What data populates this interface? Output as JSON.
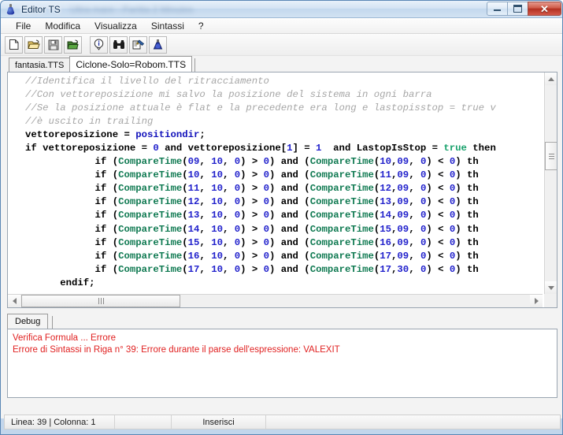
{
  "window": {
    "title": "Editor TS",
    "title_blurred_suffix": "Ultra mare - Partita 2 Minutes",
    "icon": "flask-icon",
    "controls": {
      "minimize": "–",
      "maximize": "□",
      "close": "✕"
    }
  },
  "menubar": {
    "items": [
      {
        "label": "File"
      },
      {
        "label": "Modifica"
      },
      {
        "label": "Visualizza"
      },
      {
        "label": "Sintassi"
      },
      {
        "label": "?"
      }
    ]
  },
  "toolbar": {
    "buttons": [
      {
        "name": "new-file-icon",
        "tip": "Nuovo"
      },
      {
        "name": "open-folder-icon",
        "tip": "Apri"
      },
      {
        "name": "save-floppy-icon",
        "tip": "Salva"
      },
      {
        "name": "save-as-folder-icon",
        "tip": "Salva con nome"
      },
      {
        "name": "info-icon",
        "tip": "Informazioni"
      },
      {
        "name": "binoculars-find-icon",
        "tip": "Cerca"
      },
      {
        "name": "check-syntax-icon",
        "tip": "Verifica Sintassi"
      },
      {
        "name": "flask-icon",
        "tip": "Editor TS"
      }
    ]
  },
  "file_tabs": {
    "tabs": [
      {
        "label": "fantasia.TTS",
        "active": false
      },
      {
        "label": "Ciclone-Solo=Robom.TTS",
        "active": true
      }
    ]
  },
  "editor": {
    "lines": [
      {
        "segments": [
          {
            "t": "//Identifica il livello del ritracciamento",
            "c": "cm"
          }
        ]
      },
      {
        "segments": [
          {
            "t": "//Con vettoreposizione mi salvo la posizione del sistema in ogni barra",
            "c": "cm"
          }
        ]
      },
      {
        "segments": [
          {
            "t": "//Se la posizione attuale è flat e la precedente era long e lastopisstop = true v",
            "c": "cm"
          }
        ]
      },
      {
        "segments": [
          {
            "t": "//è uscito in trailing",
            "c": "cm"
          }
        ]
      },
      {
        "segments": [
          {
            "t": "vettoreposizione = ",
            "c": "plain"
          },
          {
            "t": "positiondir",
            "c": "id"
          },
          {
            "t": ";",
            "c": "plain"
          }
        ]
      },
      {
        "segments": [
          {
            "t": "if vettoreposizione = ",
            "c": "plain"
          },
          {
            "t": "0",
            "c": "num"
          },
          {
            "t": " and vettoreposizione[",
            "c": "plain"
          },
          {
            "t": "1",
            "c": "num"
          },
          {
            "t": "] = ",
            "c": "plain"
          },
          {
            "t": "1",
            "c": "num"
          },
          {
            "t": "  and LastopIsStop = ",
            "c": "plain"
          },
          {
            "t": "true",
            "c": "val"
          },
          {
            "t": " then",
            "c": "plain"
          }
        ]
      },
      {
        "segments": [
          {
            "t": "            if (",
            "c": "plain"
          },
          {
            "t": "CompareTime",
            "c": "fn"
          },
          {
            "t": "(",
            "c": "plain"
          },
          {
            "t": "09",
            "c": "num"
          },
          {
            "t": ", ",
            "c": "plain"
          },
          {
            "t": "10",
            "c": "num"
          },
          {
            "t": ", ",
            "c": "plain"
          },
          {
            "t": "0",
            "c": "num"
          },
          {
            "t": ") > ",
            "c": "plain"
          },
          {
            "t": "0",
            "c": "num"
          },
          {
            "t": ") and (",
            "c": "plain"
          },
          {
            "t": "CompareTime",
            "c": "fn"
          },
          {
            "t": "(",
            "c": "plain"
          },
          {
            "t": "10",
            "c": "num"
          },
          {
            "t": ",",
            "c": "plain"
          },
          {
            "t": "09",
            "c": "num"
          },
          {
            "t": ", ",
            "c": "plain"
          },
          {
            "t": "0",
            "c": "num"
          },
          {
            "t": ") < ",
            "c": "plain"
          },
          {
            "t": "0",
            "c": "num"
          },
          {
            "t": ") th",
            "c": "plain"
          }
        ]
      },
      {
        "segments": [
          {
            "t": "            if (",
            "c": "plain"
          },
          {
            "t": "CompareTime",
            "c": "fn"
          },
          {
            "t": "(",
            "c": "plain"
          },
          {
            "t": "10",
            "c": "num"
          },
          {
            "t": ", ",
            "c": "plain"
          },
          {
            "t": "10",
            "c": "num"
          },
          {
            "t": ", ",
            "c": "plain"
          },
          {
            "t": "0",
            "c": "num"
          },
          {
            "t": ") > ",
            "c": "plain"
          },
          {
            "t": "0",
            "c": "num"
          },
          {
            "t": ") and (",
            "c": "plain"
          },
          {
            "t": "CompareTime",
            "c": "fn"
          },
          {
            "t": "(",
            "c": "plain"
          },
          {
            "t": "11",
            "c": "num"
          },
          {
            "t": ",",
            "c": "plain"
          },
          {
            "t": "09",
            "c": "num"
          },
          {
            "t": ", ",
            "c": "plain"
          },
          {
            "t": "0",
            "c": "num"
          },
          {
            "t": ") < ",
            "c": "plain"
          },
          {
            "t": "0",
            "c": "num"
          },
          {
            "t": ") th",
            "c": "plain"
          }
        ]
      },
      {
        "segments": [
          {
            "t": "            if (",
            "c": "plain"
          },
          {
            "t": "CompareTime",
            "c": "fn"
          },
          {
            "t": "(",
            "c": "plain"
          },
          {
            "t": "11",
            "c": "num"
          },
          {
            "t": ", ",
            "c": "plain"
          },
          {
            "t": "10",
            "c": "num"
          },
          {
            "t": ", ",
            "c": "plain"
          },
          {
            "t": "0",
            "c": "num"
          },
          {
            "t": ") > ",
            "c": "plain"
          },
          {
            "t": "0",
            "c": "num"
          },
          {
            "t": ") and (",
            "c": "plain"
          },
          {
            "t": "CompareTime",
            "c": "fn"
          },
          {
            "t": "(",
            "c": "plain"
          },
          {
            "t": "12",
            "c": "num"
          },
          {
            "t": ",",
            "c": "plain"
          },
          {
            "t": "09",
            "c": "num"
          },
          {
            "t": ", ",
            "c": "plain"
          },
          {
            "t": "0",
            "c": "num"
          },
          {
            "t": ") < ",
            "c": "plain"
          },
          {
            "t": "0",
            "c": "num"
          },
          {
            "t": ") th",
            "c": "plain"
          }
        ]
      },
      {
        "segments": [
          {
            "t": "            if (",
            "c": "plain"
          },
          {
            "t": "CompareTime",
            "c": "fn"
          },
          {
            "t": "(",
            "c": "plain"
          },
          {
            "t": "12",
            "c": "num"
          },
          {
            "t": ", ",
            "c": "plain"
          },
          {
            "t": "10",
            "c": "num"
          },
          {
            "t": ", ",
            "c": "plain"
          },
          {
            "t": "0",
            "c": "num"
          },
          {
            "t": ") > ",
            "c": "plain"
          },
          {
            "t": "0",
            "c": "num"
          },
          {
            "t": ") and (",
            "c": "plain"
          },
          {
            "t": "CompareTime",
            "c": "fn"
          },
          {
            "t": "(",
            "c": "plain"
          },
          {
            "t": "13",
            "c": "num"
          },
          {
            "t": ",",
            "c": "plain"
          },
          {
            "t": "09",
            "c": "num"
          },
          {
            "t": ", ",
            "c": "plain"
          },
          {
            "t": "0",
            "c": "num"
          },
          {
            "t": ") < ",
            "c": "plain"
          },
          {
            "t": "0",
            "c": "num"
          },
          {
            "t": ") th",
            "c": "plain"
          }
        ]
      },
      {
        "segments": [
          {
            "t": "            if (",
            "c": "plain"
          },
          {
            "t": "CompareTime",
            "c": "fn"
          },
          {
            "t": "(",
            "c": "plain"
          },
          {
            "t": "13",
            "c": "num"
          },
          {
            "t": ", ",
            "c": "plain"
          },
          {
            "t": "10",
            "c": "num"
          },
          {
            "t": ", ",
            "c": "plain"
          },
          {
            "t": "0",
            "c": "num"
          },
          {
            "t": ") > ",
            "c": "plain"
          },
          {
            "t": "0",
            "c": "num"
          },
          {
            "t": ") and (",
            "c": "plain"
          },
          {
            "t": "CompareTime",
            "c": "fn"
          },
          {
            "t": "(",
            "c": "plain"
          },
          {
            "t": "14",
            "c": "num"
          },
          {
            "t": ",",
            "c": "plain"
          },
          {
            "t": "09",
            "c": "num"
          },
          {
            "t": ", ",
            "c": "plain"
          },
          {
            "t": "0",
            "c": "num"
          },
          {
            "t": ") < ",
            "c": "plain"
          },
          {
            "t": "0",
            "c": "num"
          },
          {
            "t": ") th",
            "c": "plain"
          }
        ]
      },
      {
        "segments": [
          {
            "t": "            if (",
            "c": "plain"
          },
          {
            "t": "CompareTime",
            "c": "fn"
          },
          {
            "t": "(",
            "c": "plain"
          },
          {
            "t": "14",
            "c": "num"
          },
          {
            "t": ", ",
            "c": "plain"
          },
          {
            "t": "10",
            "c": "num"
          },
          {
            "t": ", ",
            "c": "plain"
          },
          {
            "t": "0",
            "c": "num"
          },
          {
            "t": ") > ",
            "c": "plain"
          },
          {
            "t": "0",
            "c": "num"
          },
          {
            "t": ") and (",
            "c": "plain"
          },
          {
            "t": "CompareTime",
            "c": "fn"
          },
          {
            "t": "(",
            "c": "plain"
          },
          {
            "t": "15",
            "c": "num"
          },
          {
            "t": ",",
            "c": "plain"
          },
          {
            "t": "09",
            "c": "num"
          },
          {
            "t": ", ",
            "c": "plain"
          },
          {
            "t": "0",
            "c": "num"
          },
          {
            "t": ") < ",
            "c": "plain"
          },
          {
            "t": "0",
            "c": "num"
          },
          {
            "t": ") th",
            "c": "plain"
          }
        ]
      },
      {
        "segments": [
          {
            "t": "            if (",
            "c": "plain"
          },
          {
            "t": "CompareTime",
            "c": "fn"
          },
          {
            "t": "(",
            "c": "plain"
          },
          {
            "t": "15",
            "c": "num"
          },
          {
            "t": ", ",
            "c": "plain"
          },
          {
            "t": "10",
            "c": "num"
          },
          {
            "t": ", ",
            "c": "plain"
          },
          {
            "t": "0",
            "c": "num"
          },
          {
            "t": ") > ",
            "c": "plain"
          },
          {
            "t": "0",
            "c": "num"
          },
          {
            "t": ") and (",
            "c": "plain"
          },
          {
            "t": "CompareTime",
            "c": "fn"
          },
          {
            "t": "(",
            "c": "plain"
          },
          {
            "t": "16",
            "c": "num"
          },
          {
            "t": ",",
            "c": "plain"
          },
          {
            "t": "09",
            "c": "num"
          },
          {
            "t": ", ",
            "c": "plain"
          },
          {
            "t": "0",
            "c": "num"
          },
          {
            "t": ") < ",
            "c": "plain"
          },
          {
            "t": "0",
            "c": "num"
          },
          {
            "t": ") th",
            "c": "plain"
          }
        ]
      },
      {
        "segments": [
          {
            "t": "            if (",
            "c": "plain"
          },
          {
            "t": "CompareTime",
            "c": "fn"
          },
          {
            "t": "(",
            "c": "plain"
          },
          {
            "t": "16",
            "c": "num"
          },
          {
            "t": ", ",
            "c": "plain"
          },
          {
            "t": "10",
            "c": "num"
          },
          {
            "t": ", ",
            "c": "plain"
          },
          {
            "t": "0",
            "c": "num"
          },
          {
            "t": ") > ",
            "c": "plain"
          },
          {
            "t": "0",
            "c": "num"
          },
          {
            "t": ") and (",
            "c": "plain"
          },
          {
            "t": "CompareTime",
            "c": "fn"
          },
          {
            "t": "(",
            "c": "plain"
          },
          {
            "t": "17",
            "c": "num"
          },
          {
            "t": ",",
            "c": "plain"
          },
          {
            "t": "09",
            "c": "num"
          },
          {
            "t": ", ",
            "c": "plain"
          },
          {
            "t": "0",
            "c": "num"
          },
          {
            "t": ") < ",
            "c": "plain"
          },
          {
            "t": "0",
            "c": "num"
          },
          {
            "t": ") th",
            "c": "plain"
          }
        ]
      },
      {
        "segments": [
          {
            "t": "            if (",
            "c": "plain"
          },
          {
            "t": "CompareTime",
            "c": "fn"
          },
          {
            "t": "(",
            "c": "plain"
          },
          {
            "t": "17",
            "c": "num"
          },
          {
            "t": ", ",
            "c": "plain"
          },
          {
            "t": "10",
            "c": "num"
          },
          {
            "t": ", ",
            "c": "plain"
          },
          {
            "t": "0",
            "c": "num"
          },
          {
            "t": ") > ",
            "c": "plain"
          },
          {
            "t": "0",
            "c": "num"
          },
          {
            "t": ") and (",
            "c": "plain"
          },
          {
            "t": "CompareTime",
            "c": "fn"
          },
          {
            "t": "(",
            "c": "plain"
          },
          {
            "t": "17",
            "c": "num"
          },
          {
            "t": ",",
            "c": "plain"
          },
          {
            "t": "30",
            "c": "num"
          },
          {
            "t": ", ",
            "c": "plain"
          },
          {
            "t": "0",
            "c": "num"
          },
          {
            "t": ") < ",
            "c": "plain"
          },
          {
            "t": "0",
            "c": "num"
          },
          {
            "t": ") th",
            "c": "plain"
          }
        ]
      },
      {
        "segments": [
          {
            "t": "      endif;",
            "c": "plain"
          }
        ]
      }
    ]
  },
  "debug_panel": {
    "tabs": [
      {
        "label": "Debug",
        "active": true
      }
    ],
    "messages": [
      "Verifica Formula ... Errore",
      "Errore di Sintassi in Riga n° 39: Errore durante il parse dell'espressione: VALEXIT"
    ],
    "error_color": "#e02020"
  },
  "statusbar": {
    "cells": [
      {
        "label": "Linea: 39 | Colonna:  1"
      },
      {
        "label": ""
      },
      {
        "label": "Inserisci"
      },
      {
        "label": ""
      }
    ]
  }
}
